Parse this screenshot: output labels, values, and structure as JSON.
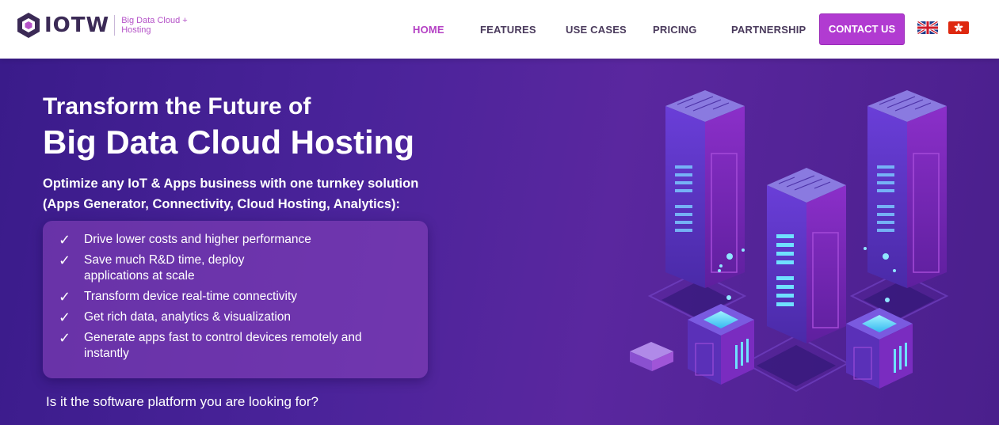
{
  "header": {
    "logo_text": "IOTW",
    "tagline_line1": "Big Data Cloud +",
    "tagline_line2": "Hosting",
    "nav": [
      {
        "label": "HOME",
        "active": true
      },
      {
        "label": "FEATURES",
        "active": false
      },
      {
        "label": "USE CASES",
        "active": false
      },
      {
        "label": "PRICING",
        "active": false
      },
      {
        "label": "PARTNERSHIP",
        "active": false
      }
    ],
    "contact_label": "CONTACT US",
    "flags": [
      "uk-flag-icon",
      "hong-kong-flag-icon"
    ]
  },
  "hero": {
    "title_line1": "Transform the Future of",
    "title_line2": "Big Data Cloud Hosting",
    "subtitle": "Optimize any IoT & Apps business with one turnkey solution (Apps Generator, Connectivity, Cloud Hosting, Analytics):",
    "check_glyph": "✓",
    "features": [
      "Drive lower costs and higher performance",
      "Save much R&D time, deploy\napplications at scale",
      "Transform device real-time connectivity",
      "Get rich data, analytics & visualization",
      "Generate apps fast to control devices remotely and instantly"
    ],
    "question": "Is it the software platform you are looking for?"
  },
  "colors": {
    "accent": "#b13bd1",
    "nav_active": "#b440c4",
    "nav_text": "#4a3a5c",
    "hero_bg": "#4a239a"
  }
}
